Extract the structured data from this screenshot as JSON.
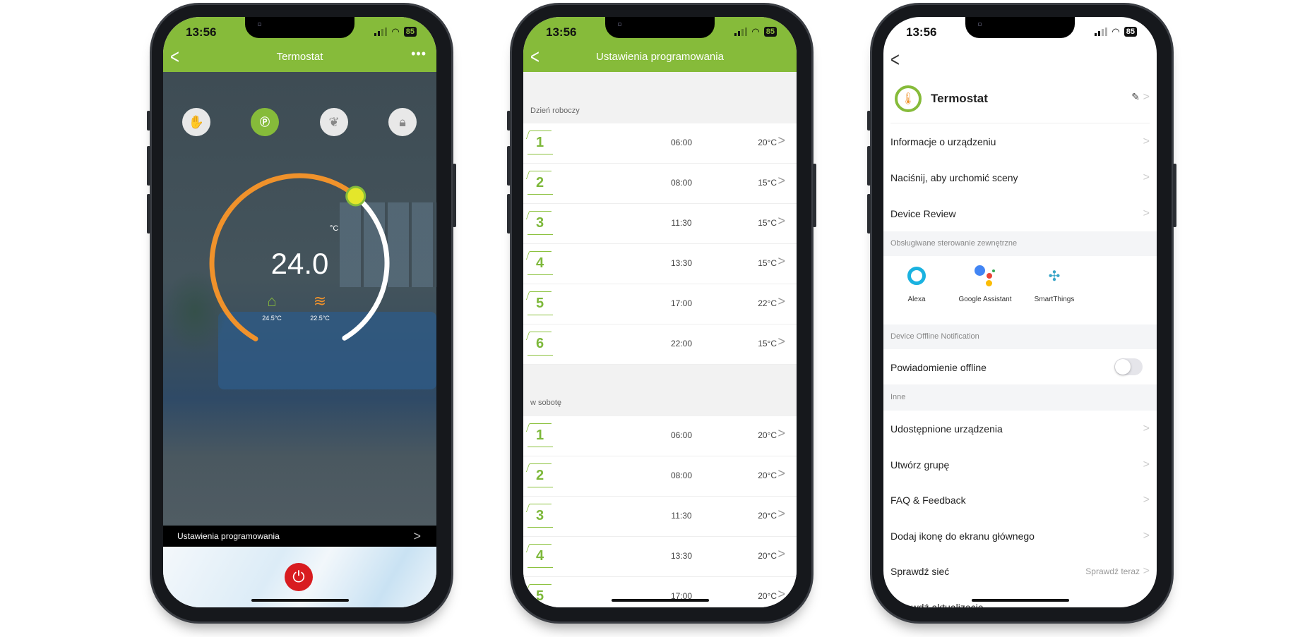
{
  "status_bar": {
    "time": "13:56",
    "battery": "85"
  },
  "thermostat": {
    "title": "Termostat",
    "modes": [
      {
        "icon": "hand-icon"
      },
      {
        "icon": "program-house-icon",
        "active": true
      },
      {
        "icon": "leaf-icon"
      },
      {
        "icon": "lock-icon"
      }
    ],
    "setpoint": "24.0",
    "unit": "°C",
    "room_temp": "24.5°C",
    "floor_temp": "22.5°C",
    "program_link": "Ustawienia programowania",
    "colors": {
      "accent": "#86bb3a",
      "arc": "#f0922b",
      "knob": "#e4e62a",
      "power": "#d81c20"
    }
  },
  "schedule": {
    "title": "Ustawienia programowania",
    "sections": [
      {
        "label": "Dzień roboczy",
        "rows": [
          {
            "period": "1",
            "time": "06:00",
            "temp": "20°C"
          },
          {
            "period": "2",
            "time": "08:00",
            "temp": "15°C"
          },
          {
            "period": "3",
            "time": "11:30",
            "temp": "15°C"
          },
          {
            "period": "4",
            "time": "13:30",
            "temp": "15°C"
          },
          {
            "period": "5",
            "time": "17:00",
            "temp": "22°C"
          },
          {
            "period": "6",
            "time": "22:00",
            "temp": "15°C"
          }
        ]
      },
      {
        "label": "w sobotę",
        "rows": [
          {
            "period": "1",
            "time": "06:00",
            "temp": "20°C"
          },
          {
            "period": "2",
            "time": "08:00",
            "temp": "20°C"
          },
          {
            "period": "3",
            "time": "11:30",
            "temp": "20°C"
          },
          {
            "period": "4",
            "time": "13:30",
            "temp": "20°C"
          },
          {
            "period": "5",
            "time": "17:00",
            "temp": "20°C"
          }
        ]
      }
    ]
  },
  "settings": {
    "device_name": "Termostat",
    "rows_top": [
      "Informacje o urządzeniu",
      "Naciśnij, aby urchomić sceny",
      "Device Review"
    ],
    "external_label": "Obsługiwane sterowanie zewnętrzne",
    "integrations": [
      "Alexa",
      "Google Assistant",
      "SmartThings"
    ],
    "offline_section": "Device Offline Notification",
    "offline_label": "Powiadomienie offline",
    "offline_enabled": false,
    "other_label": "Inne",
    "rows_other": [
      {
        "label": "Udostępnione urządzenia"
      },
      {
        "label": "Utwórz grupę"
      },
      {
        "label": "FAQ & Feedback"
      },
      {
        "label": "Dodaj ikonę do ekranu głównego"
      },
      {
        "label": "Sprawdź sieć",
        "value": "Sprawdź teraz"
      },
      {
        "label": "Sprawdź aktualizację"
      }
    ]
  }
}
